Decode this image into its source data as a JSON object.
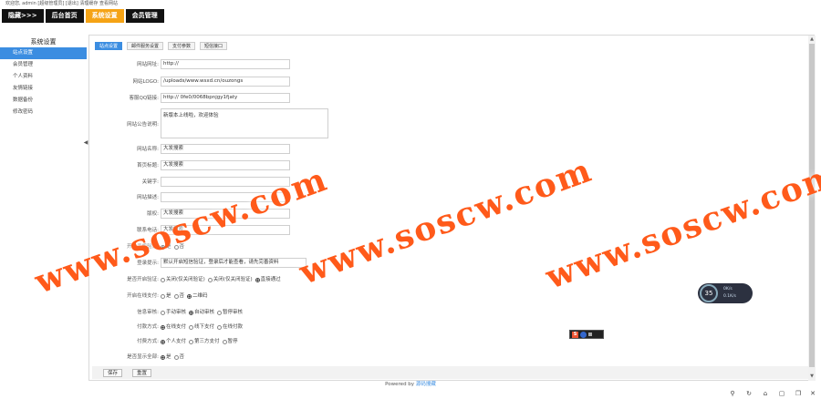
{
  "top_info": "欢迎您, admin [超级管理员] [退出] 清理缓存 查看网站",
  "topnav": [
    {
      "label": "隐藏>>>",
      "active": false
    },
    {
      "label": "后台首页",
      "active": false
    },
    {
      "label": "系统设置",
      "active": true
    },
    {
      "label": "会员管理",
      "active": false
    }
  ],
  "sidebar": {
    "title": "系统设置",
    "items": [
      {
        "label": "站点设置",
        "active": true
      },
      {
        "label": "会员管理",
        "active": false
      },
      {
        "label": "个人资料",
        "active": false
      },
      {
        "label": "友情链接",
        "active": false
      },
      {
        "label": "数据备份",
        "active": false
      },
      {
        "label": "修改密码",
        "active": false
      }
    ]
  },
  "tabs": [
    {
      "label": "站点设置",
      "active": true
    },
    {
      "label": "邮件服务设置",
      "active": false
    },
    {
      "label": "支付参数",
      "active": false
    },
    {
      "label": "短信接口",
      "active": false
    }
  ],
  "form": {
    "site_url": {
      "label": "网站网址:",
      "value": "http://"
    },
    "site_logo": {
      "label": "网站LOGO:",
      "value": "/uploads/www.wsxd.cn/ouzongs"
    },
    "qq_service": {
      "label": "客服QQ链接:",
      "value": "http://                          0fe0/0068bpnjgy1fjaty"
    },
    "site_notice": {
      "label": "网站公告说明:",
      "value": "新版本上线啦，欢迎体验"
    },
    "site_name": {
      "label": "网站名称:",
      "value": "大发搜索"
    },
    "title_name": {
      "label": "首页标题:",
      "value": "大发搜索"
    },
    "keywords": {
      "label": "关键字:",
      "value": ""
    },
    "description": {
      "label": "网站描述:",
      "value": "                    "
    },
    "copyright": {
      "label": "版权:",
      "value": "大发搜索"
    },
    "company": {
      "label": "联系电话:",
      "value": "大发搜索"
    },
    "open_reg": {
      "label": "开启手机验证:",
      "options": [
        "是",
        "否"
      ],
      "selected": 0
    },
    "login_tip": {
      "label": "登录提示:",
      "value": "默认开启短信验证，登录后才能查看，请先完善资料"
    },
    "verify_mode": {
      "label": "是否开启验证:",
      "options": [
        "关闭(仅关闭验证)",
        "关闭(仅关闭验证)",
        "直接通过"
      ],
      "selected": 2
    },
    "open_pay": {
      "label": "开启在线支付:",
      "options": [
        "是",
        "否",
        "二维码"
      ],
      "selected": 2
    },
    "audit_mode": {
      "label": "信息审核:",
      "options": [
        "手动审核",
        "自动审核",
        "暂停审核"
      ],
      "selected": 1
    },
    "pay_mode": {
      "label": "付款方式:",
      "options": [
        "在线支付",
        "线下支付",
        "在线付款"
      ],
      "selected": 0
    },
    "pay_type": {
      "label": "付费方式:",
      "options": [
        "个人支付",
        "第三方支付",
        "暂停"
      ],
      "selected": 0
    },
    "show_all": {
      "label": "是否显示全部:",
      "options": [
        "是",
        "否"
      ],
      "selected": 0
    }
  },
  "buttons": {
    "save": "保存",
    "reset": "重置"
  },
  "powered": {
    "prefix": "Powered by",
    "brand": "源码搜藏"
  },
  "watermark": "www.soscw.com",
  "speed_widget": {
    "percent": "35",
    "up": "0K/s",
    "down": "0.1K/s"
  },
  "ime_widget": {
    "letter": "S"
  }
}
